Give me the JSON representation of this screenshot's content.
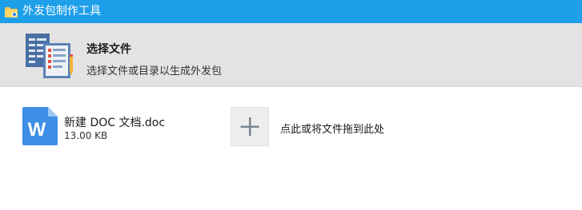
{
  "window": {
    "title": "外发包制作工具"
  },
  "header": {
    "title": "选择文件",
    "subtitle": "选择文件或目录以生成外发包"
  },
  "file": {
    "name": "新建 DOC 文档.doc",
    "size": "13.00 KB",
    "icon": "word-document-icon",
    "icon_letter": "W"
  },
  "add": {
    "label": "点此或将文件拖到此处",
    "icon": "plus-icon"
  },
  "colors": {
    "titlebar": "#1e9fe9",
    "header_bg": "#e3e3e3",
    "word_blue": "#3d8ee6"
  }
}
